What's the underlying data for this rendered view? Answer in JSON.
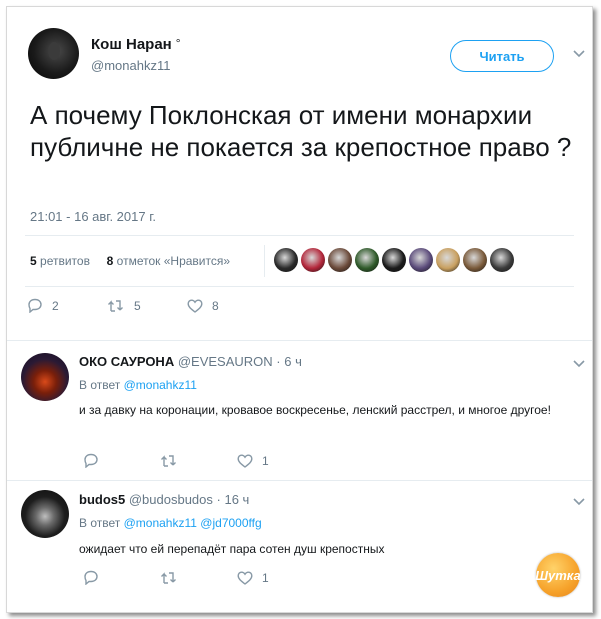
{
  "tweet": {
    "author_name": "Кош Наран",
    "author_mark": "°",
    "handle": "@monahkz11",
    "follow_label": "Читать",
    "text": "А почему Поклонская от имени монархии публичне не покается за крепостное право ?",
    "timestamp": "21:01 - 16 авг. 2017 г.",
    "retweets_count": "5",
    "retweets_label": "ретвитов",
    "likes_count": "8",
    "likes_label": "отметок «Нравится»",
    "actions": {
      "replies": "2",
      "retweets": "5",
      "likes": "8"
    },
    "liker_colors": [
      "#2a2a2a",
      "#b3263a",
      "#6b4a3a",
      "#2f5a2a",
      "#1b1b1b",
      "#5a4a7a",
      "#c9a060",
      "#7a5a3a",
      "#3a3a3a"
    ]
  },
  "replies": [
    {
      "name": "ОКО САУРОНА",
      "handle": "@EVESAURON",
      "time": "· 6 ч",
      "reply_to_label": "В ответ",
      "reply_to": [
        "@monahkz11"
      ],
      "text": "и за давку на коронации, кровавое воскресенье, ленский расстрел, и многое другое!",
      "likes": "1"
    },
    {
      "name": "budos5",
      "handle": "@budosbudos",
      "time": "· 16 ч",
      "reply_to_label": "В ответ",
      "reply_to": [
        "@monahkz11",
        "@jd7000ffg"
      ],
      "text": "ожидает что ей перепадёт пара сотен душ крепостных",
      "likes": "1"
    }
  ],
  "watermark": "Шутка",
  "colors": {
    "accent": "#1da1f2",
    "muted": "#657786",
    "text": "#14171a"
  }
}
